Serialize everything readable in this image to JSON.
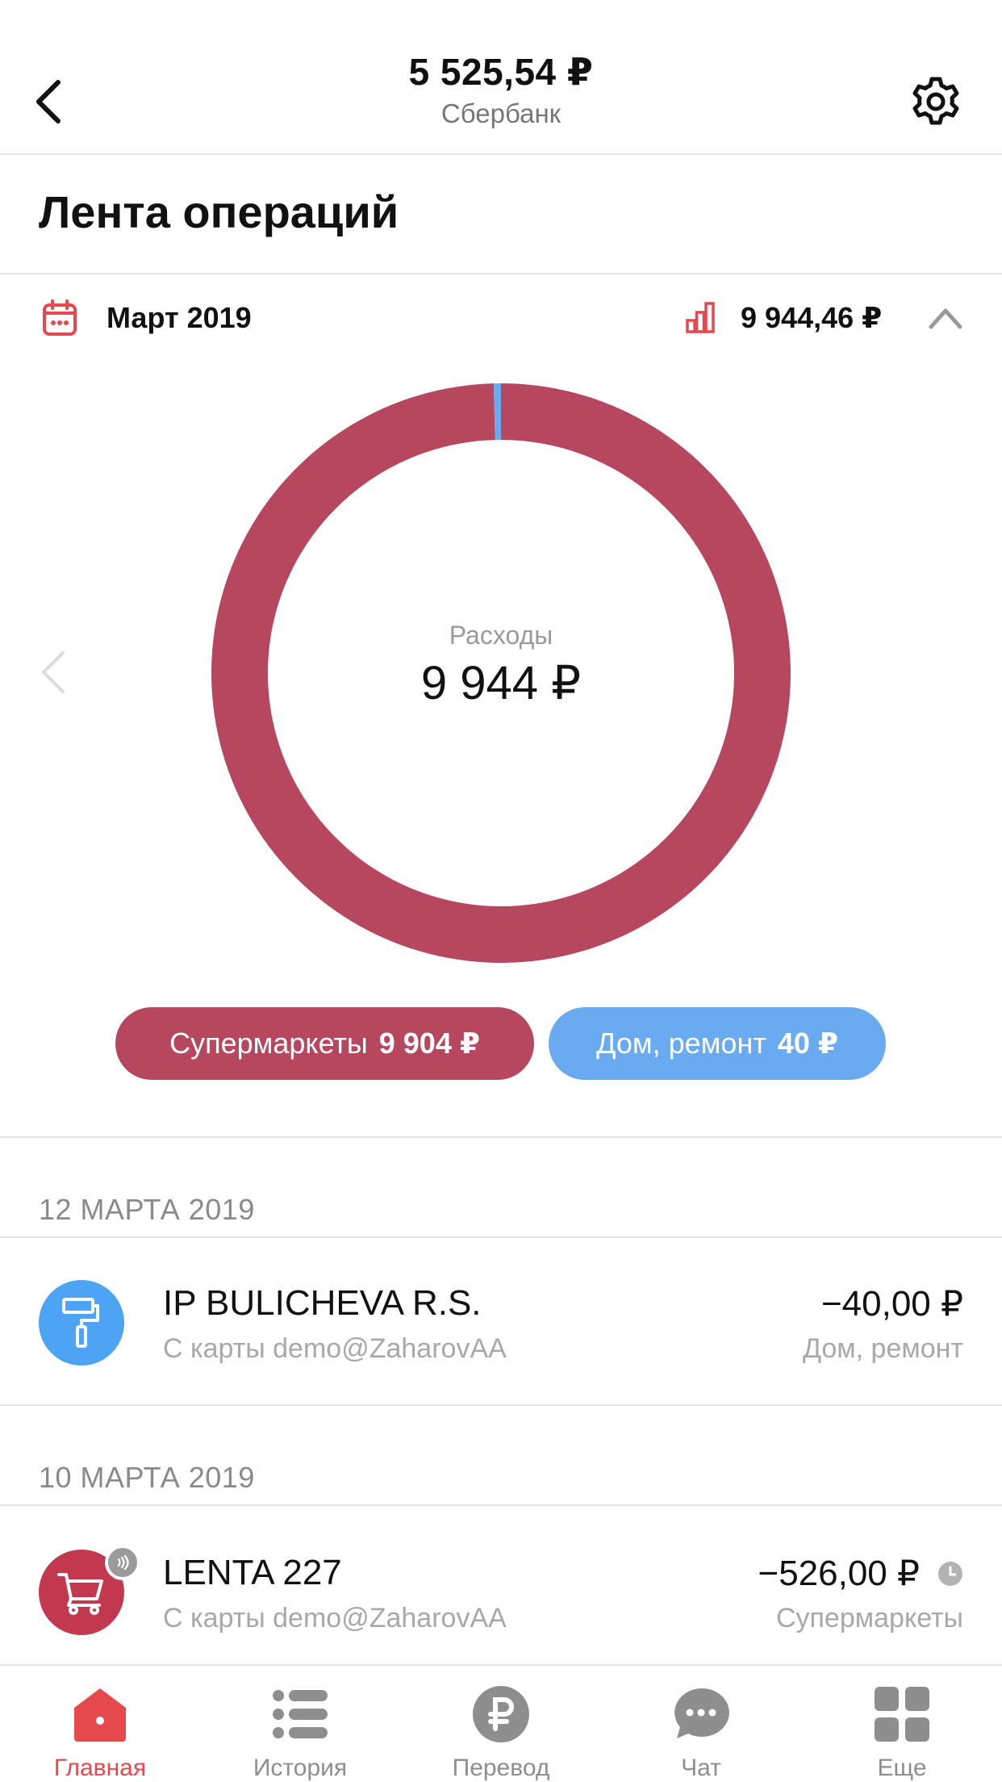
{
  "header": {
    "balance": "5 525,54 ₽",
    "bank_name": "Сбербанк",
    "back_icon": "chevron-left-icon",
    "settings_icon": "gear-icon"
  },
  "section_title": "Лента операций",
  "period": {
    "month": "Март 2019",
    "total": "9 944,46 ₽"
  },
  "chart": {
    "center_label": "Расходы",
    "center_value": "9 944 ₽"
  },
  "chart_data": {
    "type": "pie",
    "categories": [
      "Супермаркеты",
      "Дом, ремонт"
    ],
    "values": [
      9904,
      40
    ],
    "colors": [
      "#b6475e",
      "#6aaaf0"
    ]
  },
  "legend": [
    {
      "name": "Супермаркеты",
      "value": "9 904 ₽",
      "color": "#b6475e"
    },
    {
      "name": "Дом, ремонт",
      "value": "40 ₽",
      "color": "#6aaaf0"
    }
  ],
  "feed": [
    {
      "date": "12 МАРТА 2019",
      "operations": [
        {
          "title": "IP BULICHEVA R.S.",
          "subtitle": "С карты demo@ZaharovAA",
          "amount": "−40,00 ₽",
          "category": "Дом, ремонт",
          "icon": "paint-roller-icon",
          "icon_color": "#4ea4f4"
        }
      ]
    },
    {
      "date": "10 МАРТА 2019",
      "operations": [
        {
          "title": "LENTA 227",
          "subtitle": "С карты demo@ZaharovAA",
          "amount": "−526,00 ₽",
          "category": "Супермаркеты",
          "icon": "shopping-cart-icon",
          "icon_color": "#c2394f"
        }
      ]
    }
  ],
  "tabs": [
    {
      "label": "Главная",
      "icon": "home-icon",
      "active": true
    },
    {
      "label": "История",
      "icon": "list-icon",
      "active": false
    },
    {
      "label": "Перевод",
      "icon": "ruble-icon",
      "active": false
    },
    {
      "label": "Чат",
      "icon": "chat-icon",
      "active": false
    },
    {
      "label": "Еще",
      "icon": "grid-icon",
      "active": false
    }
  ],
  "colors": {
    "accent_red": "#e5484d",
    "supermarkets": "#b6475e",
    "home_repair": "#6aaaf0",
    "divider": "#e3e3e3"
  }
}
